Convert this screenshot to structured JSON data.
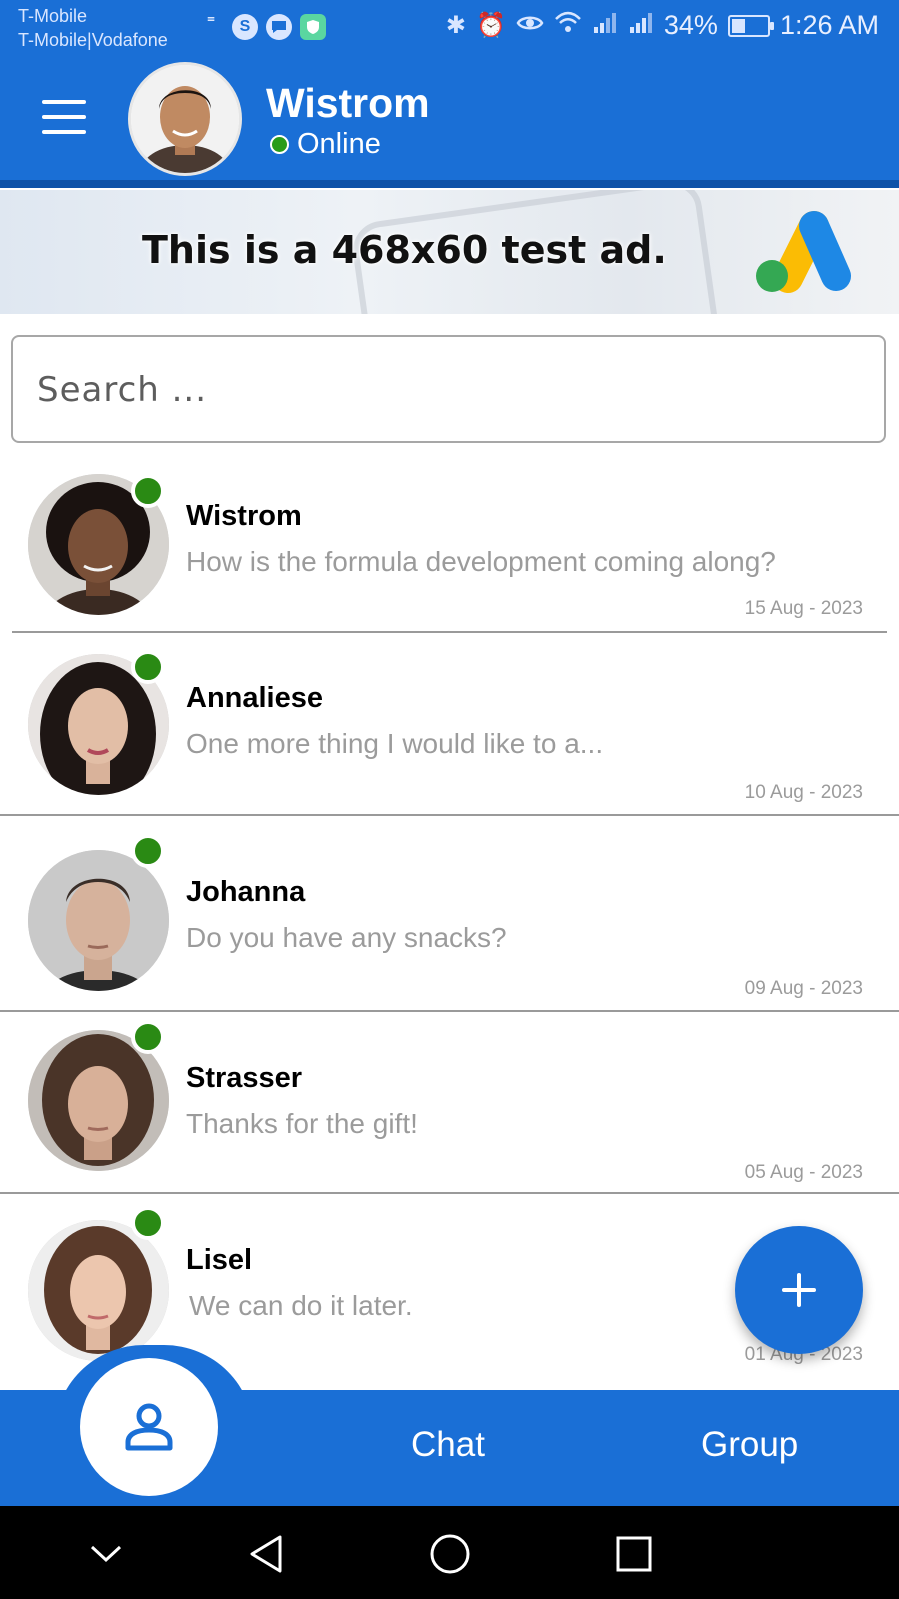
{
  "status_bar": {
    "carrier_line1": "T-Mobile",
    "carrier_line2": "T-Mobile|Vodafone",
    "battery": "34%",
    "battery_level": 0.34,
    "time": "1:26 AM",
    "icons_left": [
      "voicemail-icon",
      "skype-icon",
      "message-icon",
      "shield-icon"
    ],
    "icons_right": [
      "bluetooth-icon",
      "alarm-icon",
      "eye-icon",
      "wifi-icon",
      "signal-icon",
      "signal-icon",
      "battery-icon"
    ]
  },
  "header": {
    "name": "Wistrom",
    "status": "Online"
  },
  "ad": {
    "text": "This is a 468x60 test ad."
  },
  "search": {
    "placeholder": "Search ..."
  },
  "chats": [
    {
      "name": "Wistrom",
      "message": "How is the formula development coming along?",
      "date": "15 Aug - 2023",
      "online": true
    },
    {
      "name": "Annaliese",
      "message": "One more thing I would like to a...",
      "date": "10 Aug - 2023",
      "online": true
    },
    {
      "name": "Johanna",
      "message": "Do you have any snacks?",
      "date": "09 Aug - 2023",
      "online": true
    },
    {
      "name": "Strasser",
      "message": "Thanks for the gift!",
      "date": "05 Aug - 2023",
      "online": true
    },
    {
      "name": "Lisel",
      "message": "We can do it later.",
      "date": "01 Aug - 2023",
      "online": true
    }
  ],
  "bottom_nav": {
    "tabs": [
      {
        "label": "",
        "icon": "person-icon"
      },
      {
        "label": "Chat"
      },
      {
        "label": "Group"
      }
    ]
  },
  "colors": {
    "primary": "#1a6fd6",
    "online": "#2a8a14",
    "muted_text": "#9b9b9b"
  }
}
